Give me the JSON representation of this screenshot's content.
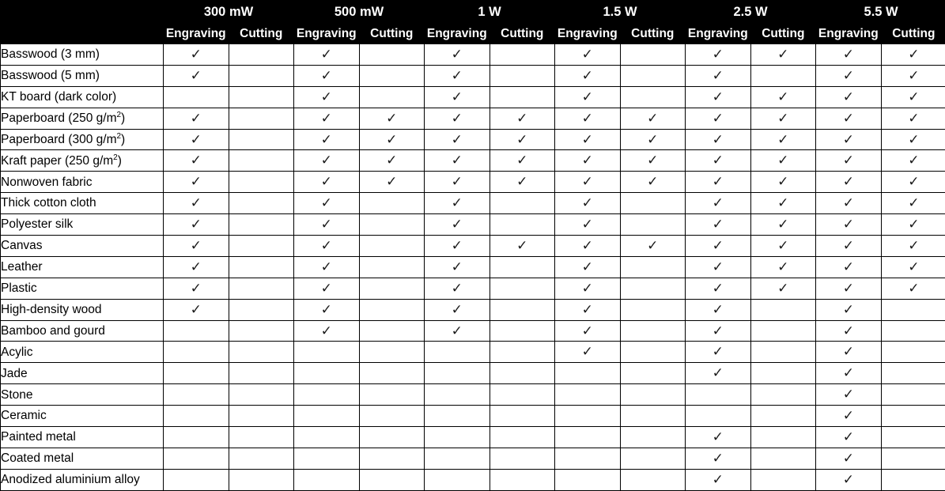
{
  "table": {
    "corner_label": "",
    "power_groups": [
      "300 mW",
      "500 mW",
      "1 W",
      "1.5 W",
      "2.5 W",
      "5.5 W"
    ],
    "mode_labels": [
      "Engraving",
      "Cutting"
    ],
    "check_glyph": "✓",
    "colors": {
      "header_background": "#000000",
      "header_text": "#ffffff",
      "body_background": "#ffffff",
      "body_text": "#000000",
      "grid_strong": "#000000",
      "grid_light": "#bfbfbf"
    },
    "rows": [
      {
        "material": "Basswood (3 mm)",
        "marks": [
          true,
          false,
          true,
          false,
          true,
          false,
          true,
          false,
          true,
          true,
          true,
          true
        ]
      },
      {
        "material": "Basswood (5 mm)",
        "marks": [
          true,
          false,
          true,
          false,
          true,
          false,
          true,
          false,
          true,
          false,
          true,
          true
        ]
      },
      {
        "material": "KT board (dark color)",
        "marks": [
          false,
          false,
          true,
          false,
          true,
          false,
          true,
          false,
          true,
          true,
          true,
          true
        ]
      },
      {
        "material": "Paperboard (250 g/m",
        "material_sup": "2",
        "material_suffix": ")",
        "marks": [
          true,
          false,
          true,
          true,
          true,
          true,
          true,
          true,
          true,
          true,
          true,
          true
        ]
      },
      {
        "material": "Paperboard (300 g/m",
        "material_sup": "2",
        "material_suffix": ")",
        "marks": [
          true,
          false,
          true,
          true,
          true,
          true,
          true,
          true,
          true,
          true,
          true,
          true
        ]
      },
      {
        "material": "Kraft paper (250 g/m",
        "material_sup": "2",
        "material_suffix": ")",
        "marks": [
          true,
          false,
          true,
          true,
          true,
          true,
          true,
          true,
          true,
          true,
          true,
          true
        ]
      },
      {
        "material": "Nonwoven fabric",
        "marks": [
          true,
          false,
          true,
          true,
          true,
          true,
          true,
          true,
          true,
          true,
          true,
          true
        ]
      },
      {
        "material": "Thick cotton cloth",
        "marks": [
          true,
          false,
          true,
          false,
          true,
          false,
          true,
          false,
          true,
          true,
          true,
          true
        ]
      },
      {
        "material": "Polyester silk",
        "marks": [
          true,
          false,
          true,
          false,
          true,
          false,
          true,
          false,
          true,
          true,
          true,
          true
        ]
      },
      {
        "material": "Canvas",
        "marks": [
          true,
          false,
          true,
          false,
          true,
          true,
          true,
          true,
          true,
          true,
          true,
          true
        ]
      },
      {
        "material": "Leather",
        "marks": [
          true,
          false,
          true,
          false,
          true,
          false,
          true,
          false,
          true,
          true,
          true,
          true
        ]
      },
      {
        "material": "Plastic",
        "marks": [
          true,
          false,
          true,
          false,
          true,
          false,
          true,
          false,
          true,
          true,
          true,
          true
        ]
      },
      {
        "material": "High-density wood",
        "marks": [
          true,
          false,
          true,
          false,
          true,
          false,
          true,
          false,
          true,
          false,
          true,
          false
        ]
      },
      {
        "material": "Bamboo and gourd",
        "marks": [
          false,
          false,
          true,
          false,
          true,
          false,
          true,
          false,
          true,
          false,
          true,
          false
        ]
      },
      {
        "material": "Acylic",
        "marks": [
          false,
          false,
          false,
          false,
          false,
          false,
          true,
          false,
          true,
          false,
          true,
          false
        ]
      },
      {
        "material": "Jade",
        "marks": [
          false,
          false,
          false,
          false,
          false,
          false,
          false,
          false,
          true,
          false,
          true,
          false
        ]
      },
      {
        "material": "Stone",
        "marks": [
          false,
          false,
          false,
          false,
          false,
          false,
          false,
          false,
          false,
          false,
          true,
          false
        ]
      },
      {
        "material": "Ceramic",
        "marks": [
          false,
          false,
          false,
          false,
          false,
          false,
          false,
          false,
          false,
          false,
          true,
          false
        ]
      },
      {
        "material": "Painted metal",
        "marks": [
          false,
          false,
          false,
          false,
          false,
          false,
          false,
          false,
          true,
          false,
          true,
          false
        ]
      },
      {
        "material": "Coated metal",
        "marks": [
          false,
          false,
          false,
          false,
          false,
          false,
          false,
          false,
          true,
          false,
          true,
          false
        ]
      },
      {
        "material": "Anodized aluminium alloy",
        "marks": [
          false,
          false,
          false,
          false,
          false,
          false,
          false,
          false,
          true,
          false,
          true,
          false
        ]
      }
    ]
  }
}
